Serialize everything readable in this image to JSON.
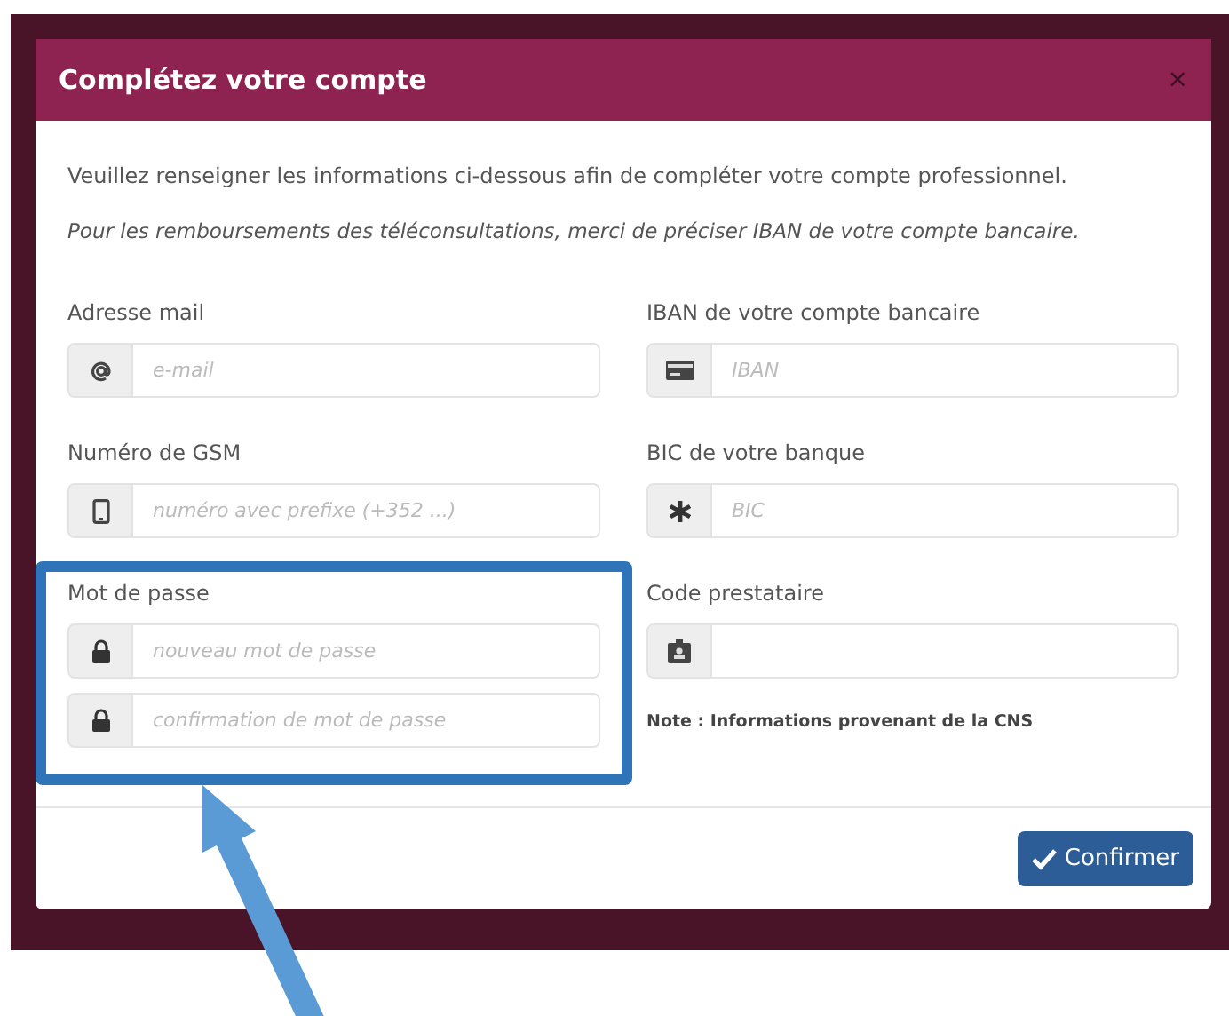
{
  "dialog": {
    "title": "Complétez votre compte",
    "close": "×"
  },
  "intro": "Veuillez renseigner les informations ci-dessous afin de compléter votre compte professionnel.",
  "notice": "Pour les remboursements des téléconsultations, merci de préciser IBAN de votre compte bancaire.",
  "left_column": [
    {
      "label": "Adresse mail",
      "inputs": [
        {
          "kind": "email",
          "placeholder": "e-mail"
        }
      ]
    },
    {
      "label": "Numéro de GSM",
      "inputs": [
        {
          "kind": "phone",
          "placeholder": "numéro avec prefixe (+352 ...)"
        }
      ]
    },
    {
      "label": "Mot de passe",
      "inputs": [
        {
          "kind": "password",
          "placeholder": "nouveau mot de passe"
        },
        {
          "kind": "password",
          "placeholder": "confirmation de mot de passe"
        }
      ]
    }
  ],
  "right_column": [
    {
      "label": "IBAN de votre compte bancaire",
      "inputs": [
        {
          "kind": "iban",
          "placeholder": "IBAN"
        }
      ]
    },
    {
      "label": "BIC de votre banque",
      "inputs": [
        {
          "kind": "bic",
          "placeholder": "BIC"
        }
      ]
    },
    {
      "label": "Code prestataire",
      "inputs": [
        {
          "kind": "code"
        }
      ]
    }
  ],
  "note": "Note : Informations provenant de la CNS",
  "confirm_button": "Confirmer"
}
